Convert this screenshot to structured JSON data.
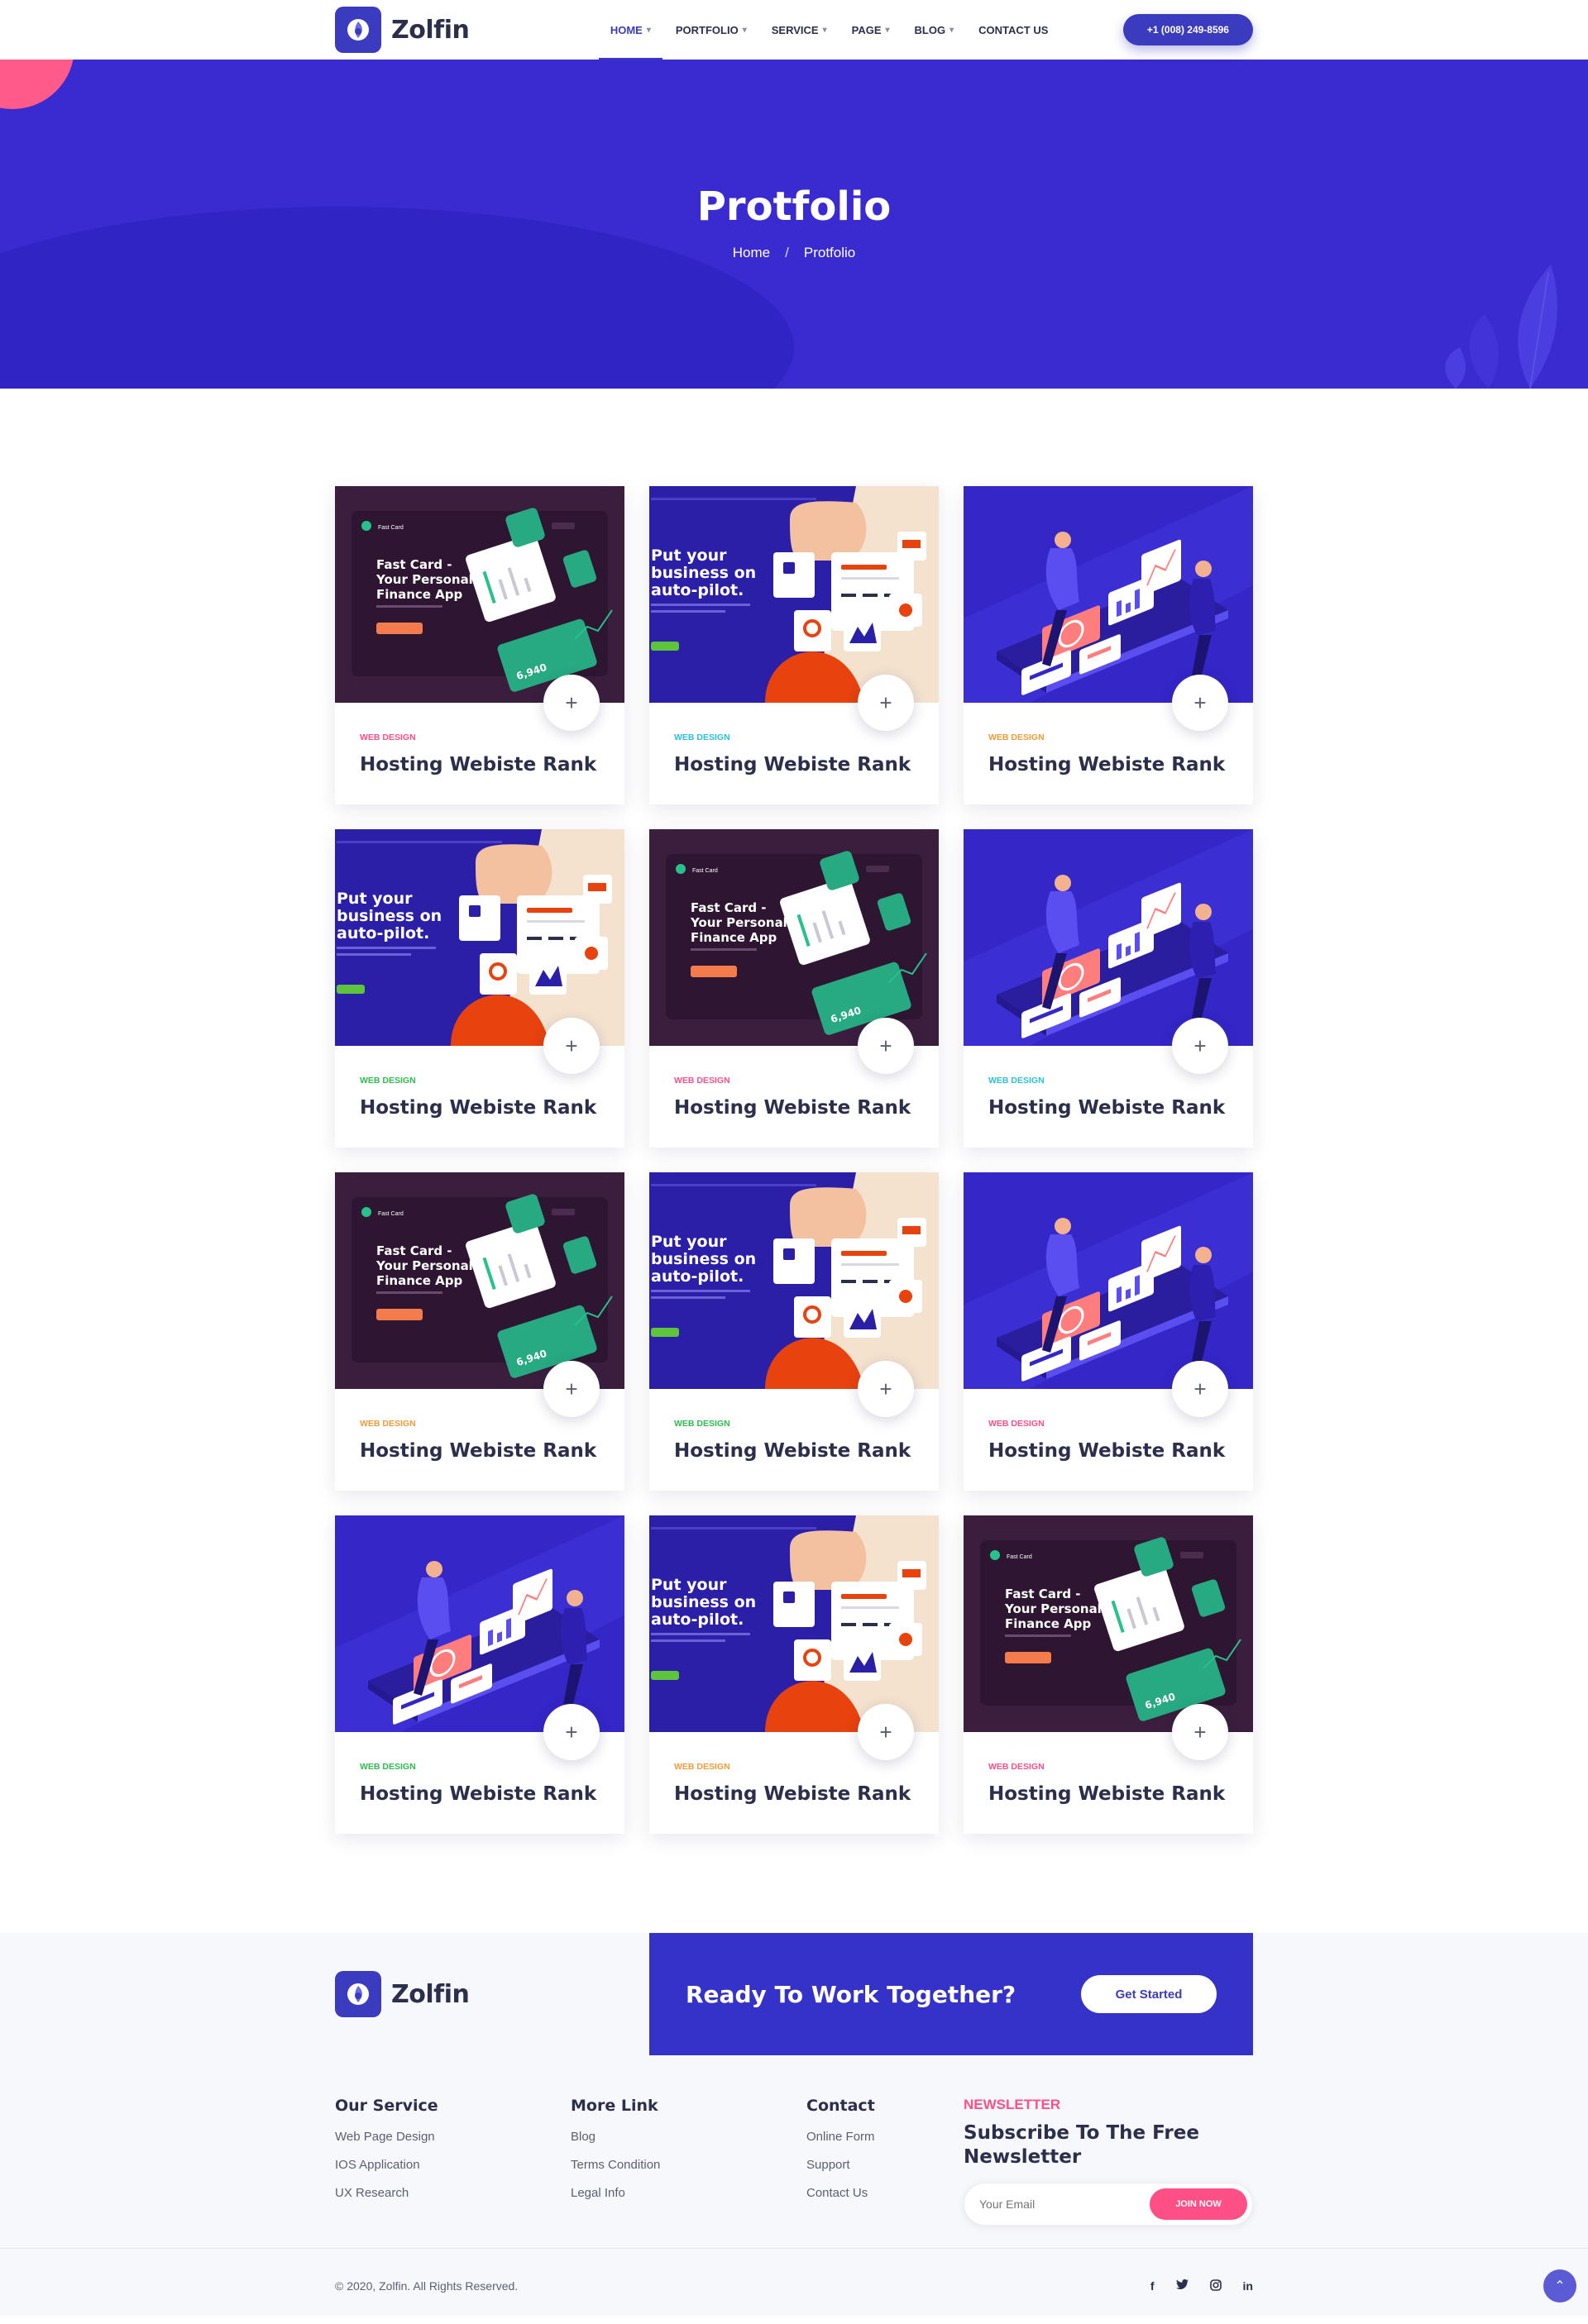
{
  "brand": {
    "name": "Zolfin",
    "accent": "#3b3bbf",
    "pink": "#ff4f87"
  },
  "nav": {
    "items": [
      {
        "label": "HOME",
        "dropdown": true
      },
      {
        "label": "PORTFOLIO",
        "dropdown": true
      },
      {
        "label": "SERVICE",
        "dropdown": true
      },
      {
        "label": "PAGE",
        "dropdown": true
      },
      {
        "label": "BLOG",
        "dropdown": true
      },
      {
        "label": "CONTACT US",
        "dropdown": false
      }
    ],
    "phone": "+1 (008) 249-8596"
  },
  "hero": {
    "title": "Protfolio",
    "breadcrumb": {
      "home": "Home",
      "separator": "/",
      "current": "Protfolio"
    }
  },
  "portfolio": {
    "items": [
      {
        "category": "WEB DESIGN",
        "cat_color": "#ff4f87",
        "title": "Hosting Webiste Rank",
        "image": "finance"
      },
      {
        "category": "WEB DESIGN",
        "cat_color": "#29c2d9",
        "title": "Hosting Webiste Rank",
        "image": "autopilot"
      },
      {
        "category": "WEB DESIGN",
        "cat_color": "#f29b3a",
        "title": "Hosting Webiste Rank",
        "image": "isometric"
      },
      {
        "category": "WEB DESIGN",
        "cat_color": "#2fbb4f",
        "title": "Hosting Webiste Rank",
        "image": "autopilot"
      },
      {
        "category": "WEB DESIGN",
        "cat_color": "#ff4f87",
        "title": "Hosting Webiste Rank",
        "image": "finance"
      },
      {
        "category": "WEB DESIGN",
        "cat_color": "#29c2d9",
        "title": "Hosting Webiste Rank",
        "image": "isometric"
      },
      {
        "category": "WEB DESIGN",
        "cat_color": "#f29b3a",
        "title": "Hosting Webiste Rank",
        "image": "finance"
      },
      {
        "category": "WEB DESIGN",
        "cat_color": "#2fbb4f",
        "title": "Hosting Webiste Rank",
        "image": "autopilot"
      },
      {
        "category": "WEB DESIGN",
        "cat_color": "#ff4f87",
        "title": "Hosting Webiste Rank",
        "image": "isometric"
      },
      {
        "category": "WEB DESIGN",
        "cat_color": "#2fbb4f",
        "title": "Hosting Webiste Rank",
        "image": "isometric"
      },
      {
        "category": "WEB DESIGN",
        "cat_color": "#f29b3a",
        "title": "Hosting Webiste Rank",
        "image": "autopilot"
      },
      {
        "category": "WEB DESIGN",
        "cat_color": "#ff4f87",
        "title": "Hosting Webiste Rank",
        "image": "finance"
      }
    ],
    "thumb_text": {
      "finance": [
        "Fast Card -",
        "Your Personal",
        "Finance App"
      ],
      "autopilot": [
        "Put your",
        "business on",
        "auto-pilot."
      ]
    }
  },
  "footer": {
    "cta": {
      "title": "Ready To Work Together?",
      "button": "Get Started"
    },
    "columns": [
      {
        "title": "Our Service",
        "links": [
          "Web Page Design",
          "IOS Application",
          "UX Research"
        ]
      },
      {
        "title": "More Link",
        "links": [
          "Blog",
          "Terms Condition",
          "Legal Info"
        ]
      },
      {
        "title": "Contact",
        "links": [
          "Online Form",
          "Support",
          "Contact Us"
        ]
      }
    ],
    "newsletter": {
      "kicker": "NEWSLETTER",
      "title": "Subscribe To The Free Newsletter",
      "placeholder": "Your Email",
      "button": "JOIN NOW"
    },
    "copyright": "© 2020, Zolfin. All Rights Reserved.",
    "social": [
      "f",
      "t",
      "ig",
      "in"
    ]
  }
}
